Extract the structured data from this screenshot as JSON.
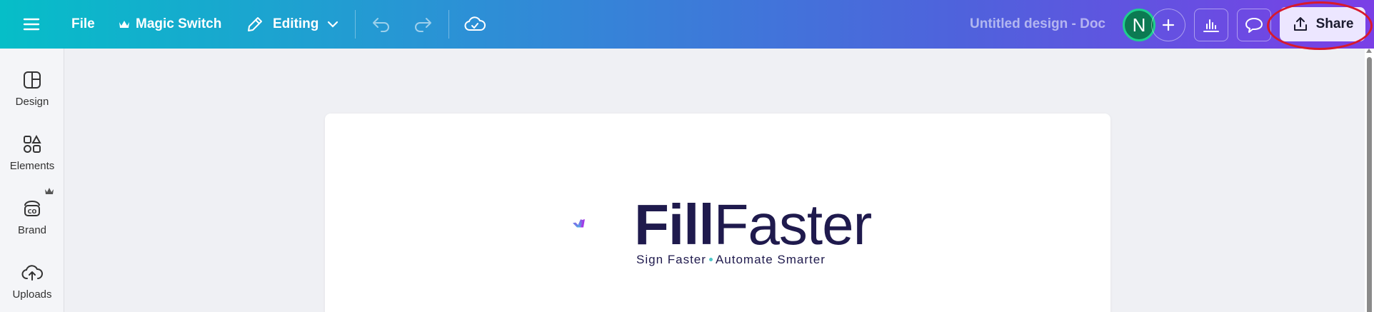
{
  "topbar": {
    "menu_icon": "hamburger-icon",
    "file_label": "File",
    "magic_switch_label": "Magic Switch",
    "editing_label": "Editing",
    "doc_title": "Untitled design - Doc",
    "avatar_initial": "N",
    "share_label": "Share",
    "icons": [
      "undo-icon",
      "redo-icon",
      "cloud-saved-icon",
      "add-icon",
      "analytics-icon",
      "comment-icon",
      "upload-icon"
    ]
  },
  "sidebar": {
    "items": [
      {
        "label": "Design",
        "icon": "design-icon"
      },
      {
        "label": "Elements",
        "icon": "elements-icon"
      },
      {
        "label": "Brand",
        "icon": "brand-icon"
      },
      {
        "label": "Uploads",
        "icon": "uploads-icon"
      }
    ]
  },
  "canvas": {
    "brand_bold": "Fill",
    "brand_light": "Faster",
    "tagline_part1": "Sign Faster",
    "tagline_part2": "Automate Smarter"
  },
  "colors": {
    "topbar_start": "#06bec8",
    "topbar_end": "#7a3fe6",
    "brand_navy": "#1f1a4d",
    "avatar_bg": "#0c7a52",
    "share_bg": "#ece6ff",
    "highlight": "#d8192c"
  }
}
